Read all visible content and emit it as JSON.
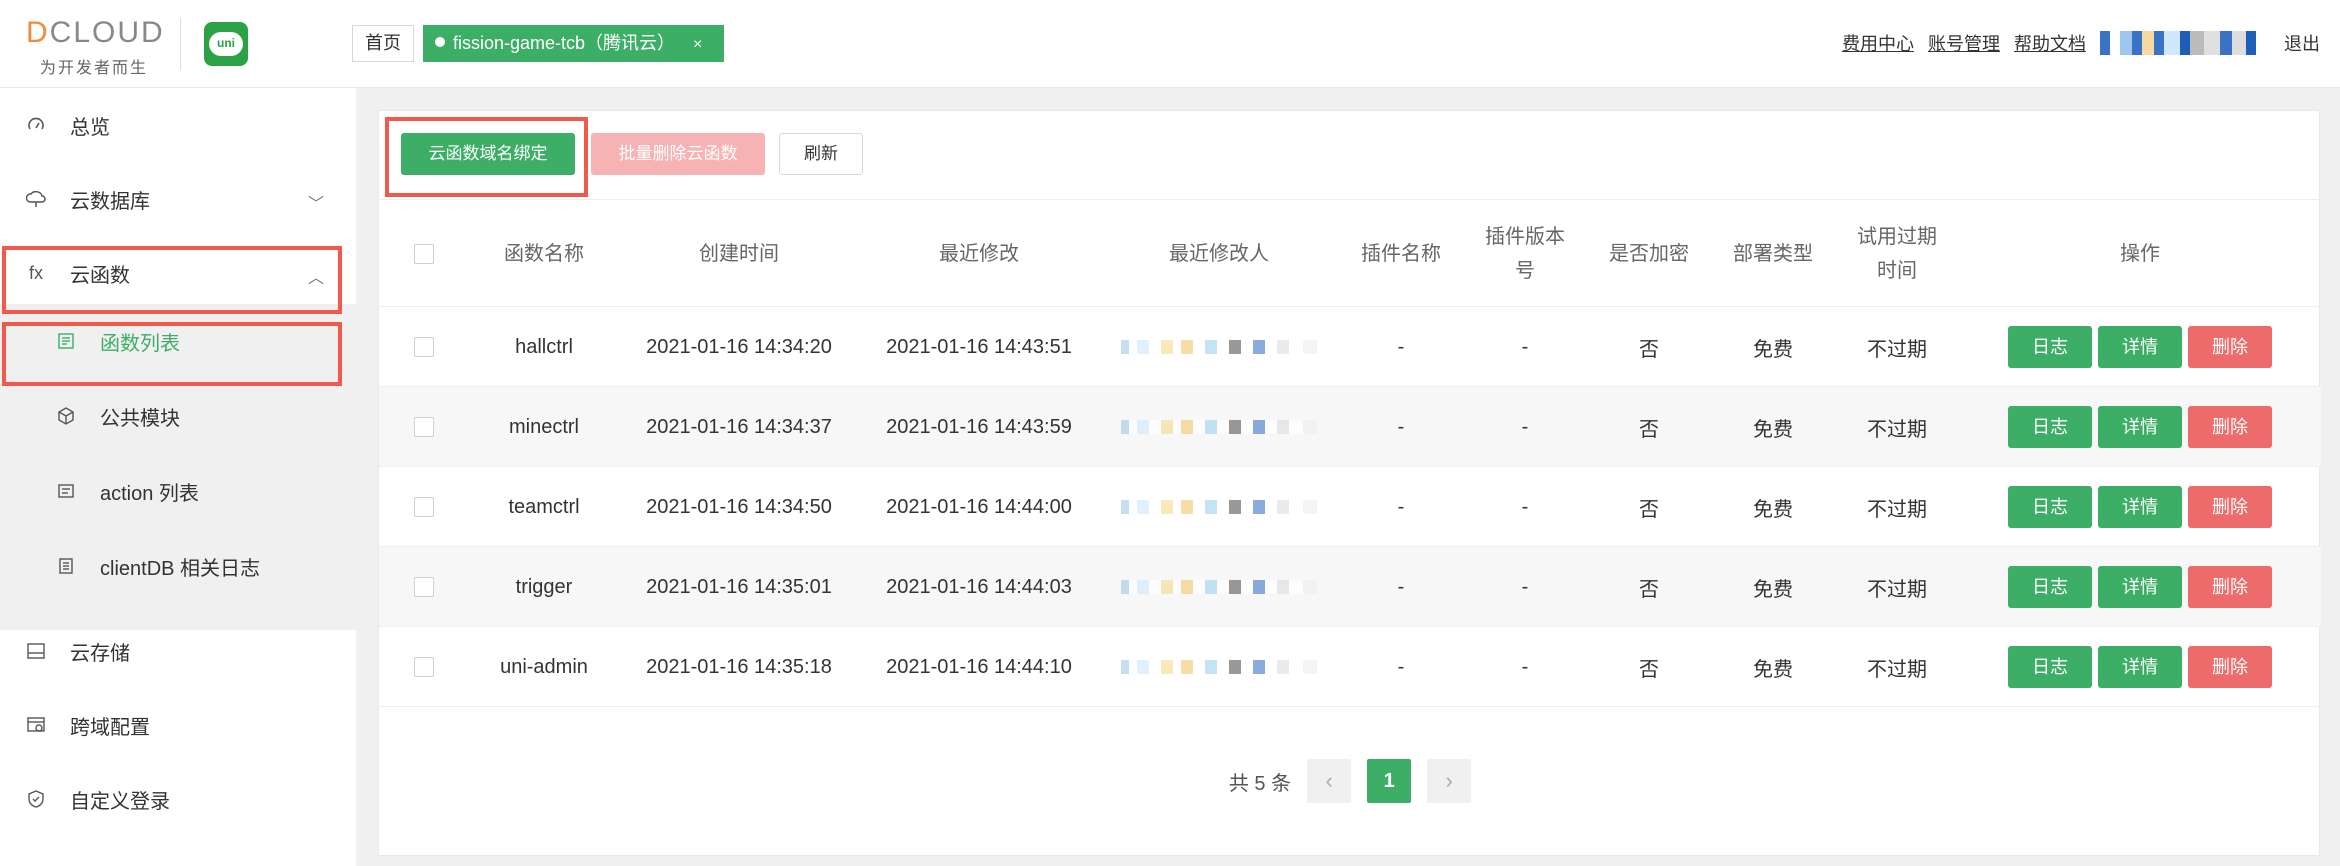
{
  "header": {
    "logo_text": "DCLOUD",
    "logo_sub": "为开发者而生",
    "uni_badge": "uni",
    "tabs": [
      {
        "label": "首页"
      },
      {
        "label": "fission-game-tcb（腾讯云）",
        "close": "×"
      }
    ],
    "links": [
      "费用中心",
      "账号管理",
      "帮助文档"
    ],
    "logout": "退出"
  },
  "sidebar": {
    "items": [
      {
        "label": "总览",
        "icon": "dashboard-icon"
      },
      {
        "label": "云数据库",
        "icon": "database-icon",
        "chevron": "﹀"
      },
      {
        "label": "云函数",
        "icon": "fx-icon",
        "icon_text": "fx",
        "chevron": "︿"
      },
      {
        "label": "云存储",
        "icon": "storage-icon"
      },
      {
        "label": "跨域配置",
        "icon": "cors-icon"
      },
      {
        "label": "自定义登录",
        "icon": "shield-icon"
      }
    ],
    "sub_items": [
      {
        "label": "函数列表",
        "icon": "list-icon"
      },
      {
        "label": "公共模块",
        "icon": "cube-icon"
      },
      {
        "label": "action 列表",
        "icon": "action-icon"
      },
      {
        "label": "clientDB 相关日志",
        "icon": "log-icon"
      }
    ]
  },
  "toolbar": {
    "bind_domain": "云函数域名绑定",
    "batch_delete": "批量删除云函数",
    "refresh": "刷新"
  },
  "table": {
    "columns": [
      "函数名称",
      "创建时间",
      "最近修改",
      "最近修改人",
      "插件名称",
      "插件版本号",
      "是否加密",
      "部署类型",
      "试用过期时间",
      "操作"
    ],
    "rows": [
      {
        "name": "hallctrl",
        "created": "2021-01-16 14:34:20",
        "modified": "2021-01-16 14:43:51",
        "plugin": "-",
        "plugin_ver": "-",
        "encrypted": "否",
        "deploy": "免费",
        "expire": "不过期"
      },
      {
        "name": "minectrl",
        "created": "2021-01-16 14:34:37",
        "modified": "2021-01-16 14:43:59",
        "plugin": "-",
        "plugin_ver": "-",
        "encrypted": "否",
        "deploy": "免费",
        "expire": "不过期"
      },
      {
        "name": "teamctrl",
        "created": "2021-01-16 14:34:50",
        "modified": "2021-01-16 14:44:00",
        "plugin": "-",
        "plugin_ver": "-",
        "encrypted": "否",
        "deploy": "免费",
        "expire": "不过期"
      },
      {
        "name": "trigger",
        "created": "2021-01-16 14:35:01",
        "modified": "2021-01-16 14:44:03",
        "plugin": "-",
        "plugin_ver": "-",
        "encrypted": "否",
        "deploy": "免费",
        "expire": "不过期"
      },
      {
        "name": "uni-admin",
        "created": "2021-01-16 14:35:18",
        "modified": "2021-01-16 14:44:10",
        "plugin": "-",
        "plugin_ver": "-",
        "encrypted": "否",
        "deploy": "免费",
        "expire": "不过期"
      }
    ],
    "actions": {
      "log": "日志",
      "detail": "详情",
      "delete": "删除"
    }
  },
  "pager": {
    "total": "共 5 条",
    "prev": "‹",
    "current": "1",
    "next": "›"
  },
  "colors": {
    "accent": "#3dae66",
    "danger": "#ee6b6b",
    "highlight": "#ef5a4c"
  }
}
